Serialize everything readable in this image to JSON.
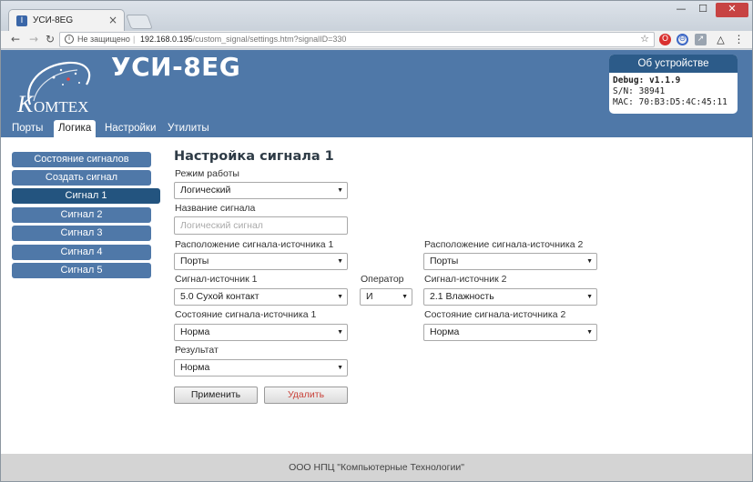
{
  "browser": {
    "tab_title": "УСИ-8EG",
    "tab_favicon": "uci-favicon",
    "security_label": "Не защищено",
    "url_host": "192.168.0.195",
    "url_path": "/custom_signal/settings.htm?signalID=330"
  },
  "header": {
    "app_name": "УСИ-8EG",
    "logo_text": "OMTEX",
    "device": {
      "title": "Об устройстве",
      "debug": "Debug: v1.1.9",
      "sn": "S/N: 38941",
      "mac": "MAC: 70:B3:D5:4C:45:11"
    },
    "nav": [
      "Порты",
      "Логика",
      "Настройки",
      "Утилиты"
    ],
    "active_nav": "Логика"
  },
  "sidebar": {
    "items": [
      "Состояние сигналов",
      "Создать сигнал",
      "Сигнал 1",
      "Сигнал 2",
      "Сигнал 3",
      "Сигнал 4",
      "Сигнал 5"
    ],
    "active": "Сигнал 1"
  },
  "form": {
    "title": "Настройка сигнала 1",
    "mode_label": "Режим работы",
    "mode_value": "Логический",
    "name_label": "Название сигнала",
    "name_placeholder": "Логический сигнал",
    "loc1_label": "Расположение сигнала-источника 1",
    "loc1_value": "Порты",
    "loc2_label": "Расположение сигнала-источника 2",
    "loc2_value": "Порты",
    "src1_label": "Сигнал-источник 1",
    "src1_value": "5.0 Сухой контакт",
    "operator_label": "Оператор",
    "operator_value": "И",
    "src2_label": "Сигнал-источник 2",
    "src2_value": "2.1 Влажность",
    "state1_label": "Состояние сигнала-источника 1",
    "state1_value": "Норма",
    "state2_label": "Состояние сигнала-источника 2",
    "state2_value": "Норма",
    "result_label": "Результат",
    "result_value": "Норма",
    "apply_label": "Применить",
    "delete_label": "Удалить"
  },
  "footer": {
    "text": "ООО НПЦ \"Компьютерные Технологии\""
  },
  "colors": {
    "header_bg": "#4f78a8",
    "sidebar_active": "#23547f",
    "device_header": "#2c5b89",
    "delete_text": "#c9423a"
  }
}
